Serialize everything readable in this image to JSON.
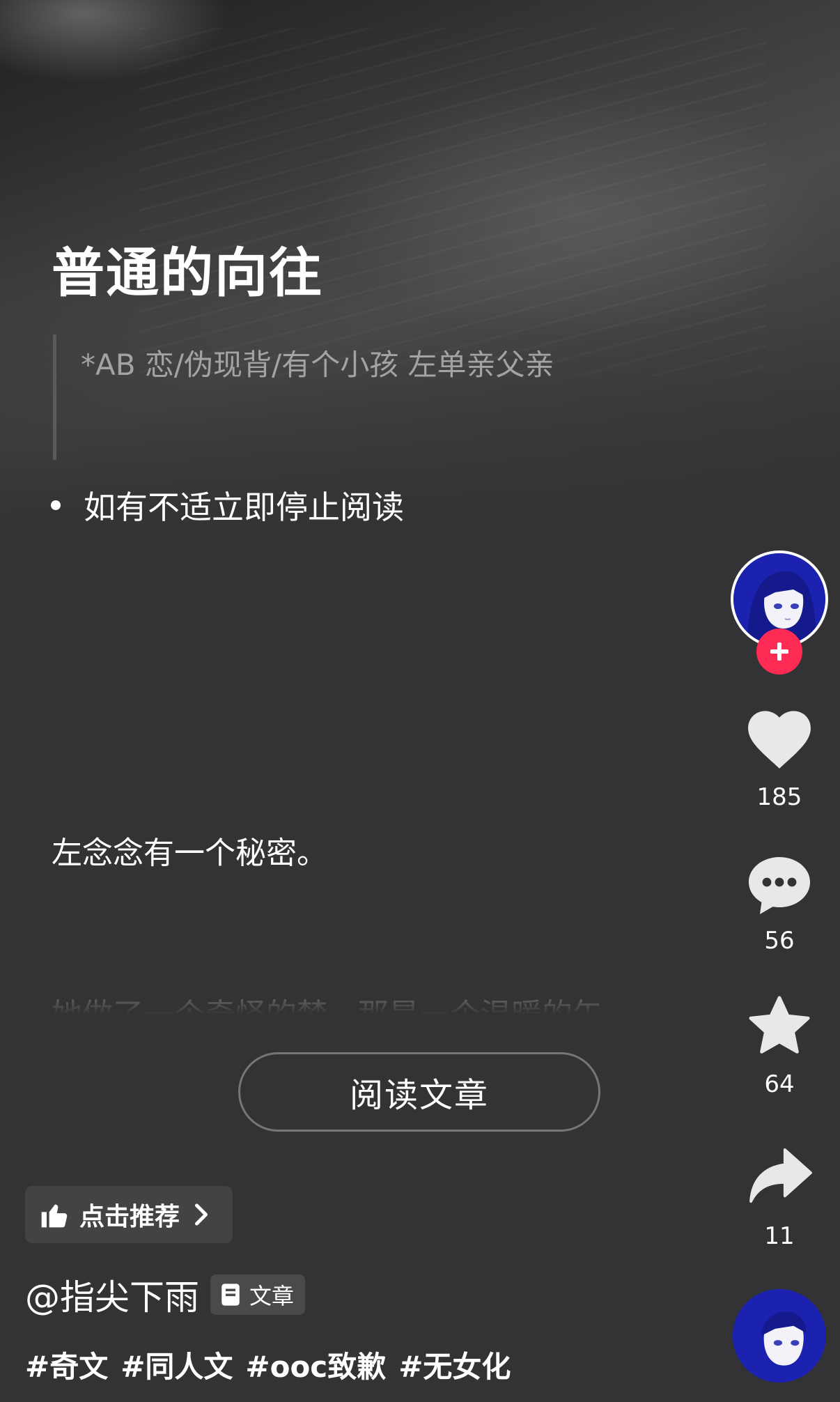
{
  "post": {
    "title": "普通的向往",
    "quote": "*AB 恋/伪现背/有个小孩 左单亲父亲",
    "bullet": "如有不适立即停止阅读",
    "paragraph_1": "左念念有一个秘密。",
    "paragraph_2": "她做了一个奇怪的梦，那是一个温暖的午",
    "read_button_label": "阅读文章"
  },
  "recommend": {
    "label": "点击推荐",
    "icon": "thumbs-up-icon"
  },
  "author": {
    "handle": "@指尖下雨",
    "type_badge": "文章"
  },
  "hashtags": [
    "#奇文",
    "#同人文",
    "#ooc致歉",
    "#无女化"
  ],
  "rail": {
    "like_count": "185",
    "comment_count": "56",
    "favorite_count": "64",
    "share_count": "11"
  },
  "colors": {
    "background": "#333335",
    "follow_accent": "#fe2c55",
    "avatar_blue": "#1c22b0"
  }
}
